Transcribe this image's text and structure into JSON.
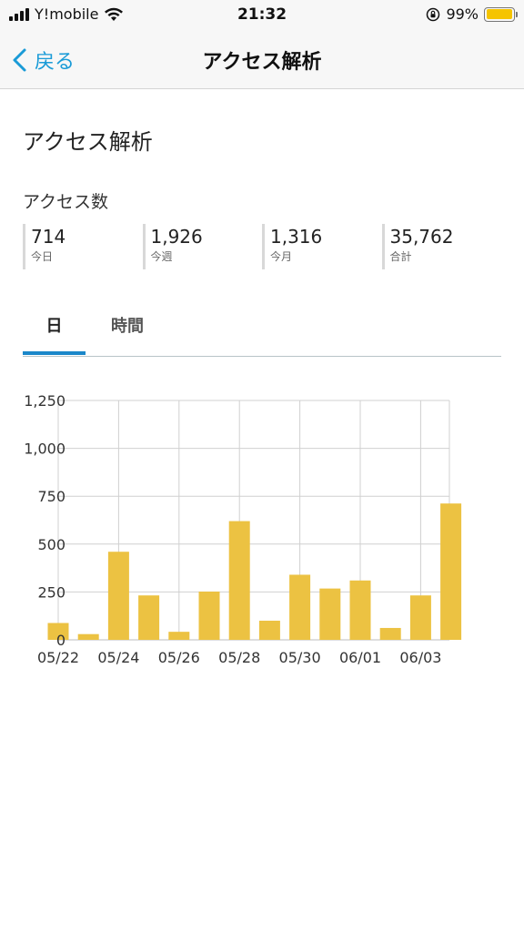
{
  "status_bar": {
    "carrier": "Y!mobile",
    "time": "21:32",
    "battery_percent": "99%",
    "battery_level": 0.99,
    "battery_color": "#f5c400"
  },
  "nav": {
    "back_label": "戻る",
    "title": "アクセス解析"
  },
  "page": {
    "heading": "アクセス解析",
    "section_label": "アクセス数",
    "stats": [
      {
        "value": "714",
        "label": "今日"
      },
      {
        "value": "1,926",
        "label": "今週"
      },
      {
        "value": "1,316",
        "label": "今月"
      },
      {
        "value": "35,762",
        "label": "合計"
      }
    ],
    "tabs": [
      {
        "label": "日",
        "active": true
      },
      {
        "label": "時間",
        "active": false
      }
    ]
  },
  "chart_data": {
    "type": "bar",
    "categories": [
      "05/22",
      "05/23",
      "05/24",
      "05/25",
      "05/26",
      "05/27",
      "05/28",
      "05/29",
      "05/30",
      "05/31",
      "06/01",
      "06/02",
      "06/03",
      "06/04"
    ],
    "x_tick_labels": [
      "05/22",
      "05/24",
      "05/26",
      "05/28",
      "05/30",
      "06/01",
      "06/03"
    ],
    "values": [
      88,
      30,
      460,
      232,
      42,
      252,
      620,
      100,
      340,
      268,
      310,
      62,
      232,
      712
    ],
    "ylim": [
      0,
      1250
    ],
    "y_ticks": [
      "0",
      "250",
      "500",
      "750",
      "1,000",
      "1,250"
    ],
    "y_tick_values": [
      0,
      250,
      500,
      750,
      1000,
      1250
    ],
    "grid": true,
    "bar_color": "#ecc242"
  }
}
